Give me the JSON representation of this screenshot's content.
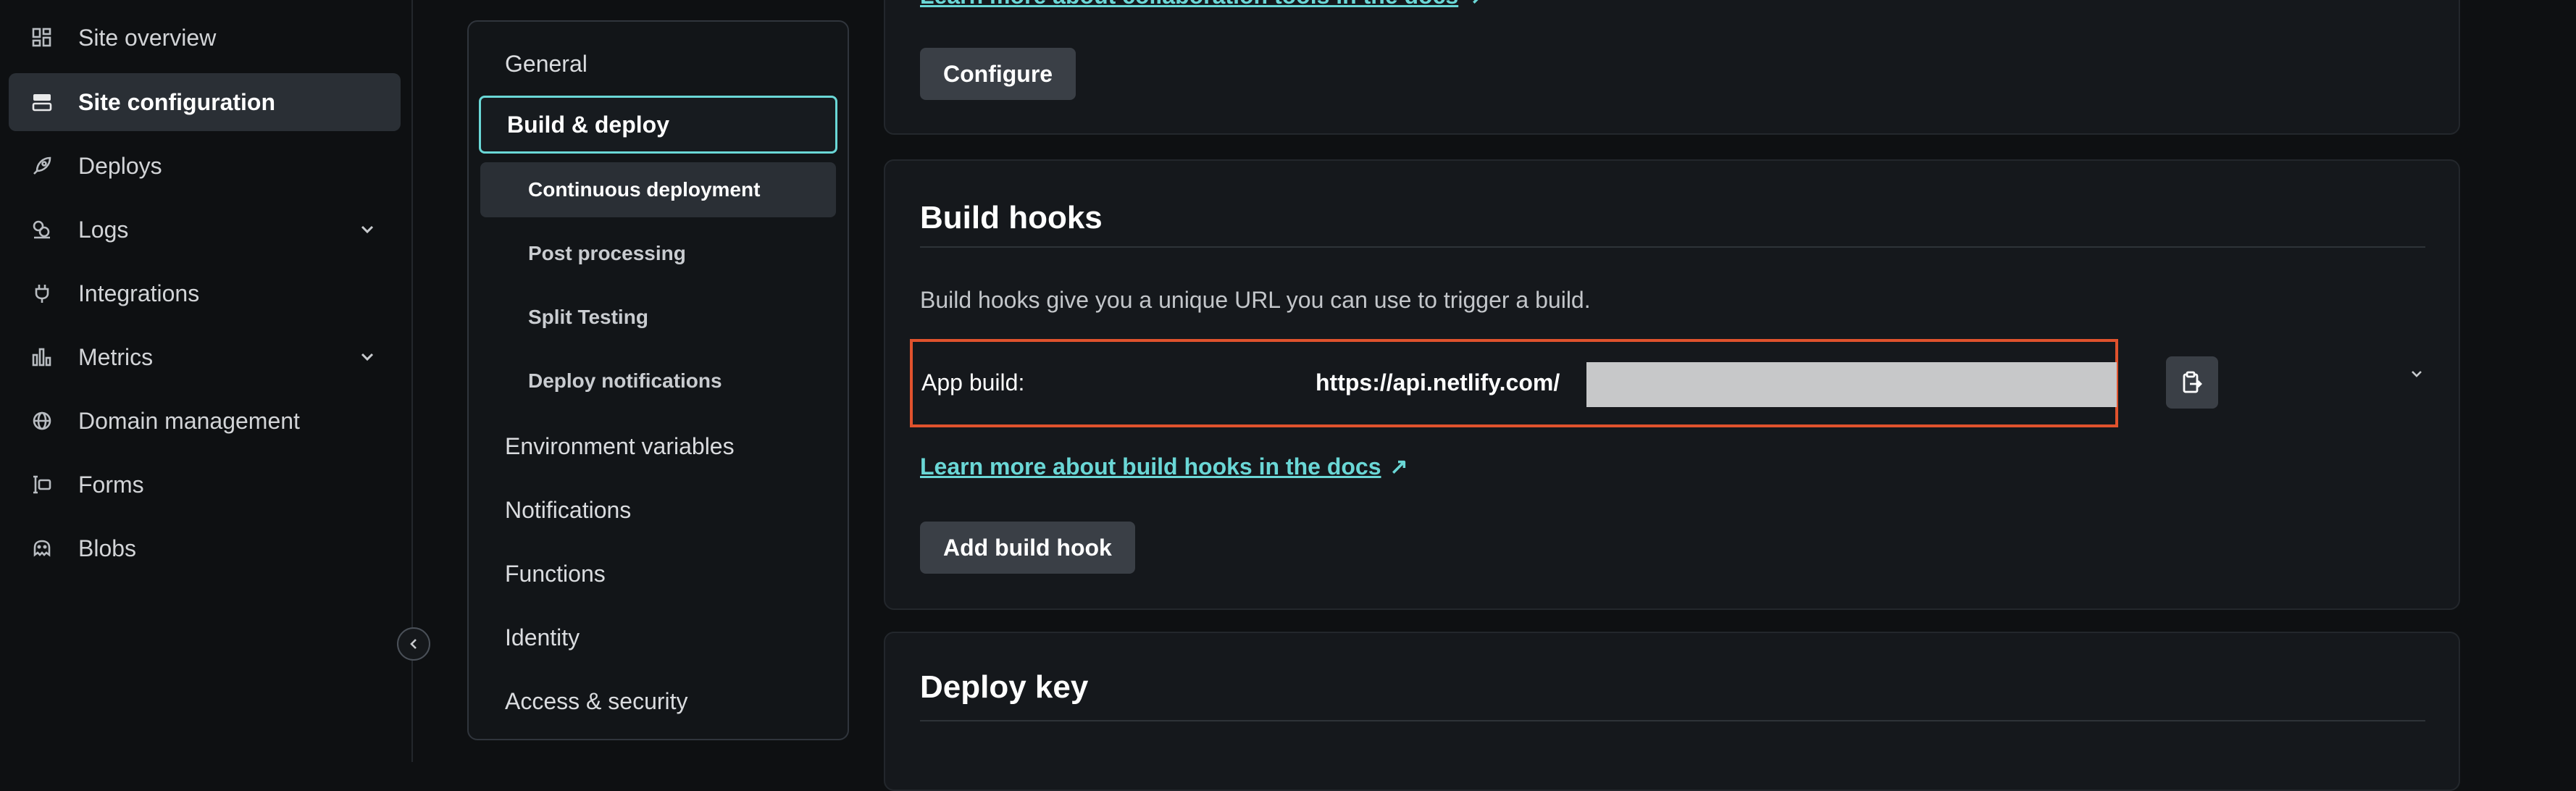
{
  "sidebar": {
    "items": [
      {
        "label": "Site overview",
        "icon": "grid-icon"
      },
      {
        "label": "Site configuration",
        "icon": "server-icon",
        "active": true
      },
      {
        "label": "Deploys",
        "icon": "rocket-icon"
      },
      {
        "label": "Logs",
        "icon": "logs-icon",
        "expandable": true
      },
      {
        "label": "Integrations",
        "icon": "plug-icon"
      },
      {
        "label": "Metrics",
        "icon": "bar-chart-icon",
        "expandable": true
      },
      {
        "label": "Domain management",
        "icon": "globe-icon"
      },
      {
        "label": "Forms",
        "icon": "form-icon"
      },
      {
        "label": "Blobs",
        "icon": "blob-icon"
      }
    ]
  },
  "settings_menu": {
    "items": [
      {
        "label": "General"
      },
      {
        "label": "Build & deploy",
        "current": true
      },
      {
        "label": "Environment variables"
      },
      {
        "label": "Notifications"
      },
      {
        "label": "Functions"
      },
      {
        "label": "Identity"
      },
      {
        "label": "Access & security"
      }
    ],
    "children": [
      {
        "label": "Continuous deployment",
        "active": true
      },
      {
        "label": "Post processing"
      },
      {
        "label": "Split Testing"
      },
      {
        "label": "Deploy notifications"
      }
    ]
  },
  "collab_card": {
    "link_text": "Learn more about collaboration tools in the docs",
    "button_label": "Configure"
  },
  "build_hooks": {
    "title": "Build hooks",
    "description": "Build hooks give you a unique URL you can use to trigger a build.",
    "hook": {
      "label": "App build:",
      "url": "https://api.netlify.com/"
    },
    "learn_link": "Learn more about build hooks in the docs",
    "add_button": "Add build hook"
  },
  "deploy_key": {
    "title": "Deploy key"
  },
  "colors": {
    "accent": "#6ad7d6",
    "highlight_box": "#e0522d",
    "background": "#0e1012",
    "card": "#15181c"
  }
}
